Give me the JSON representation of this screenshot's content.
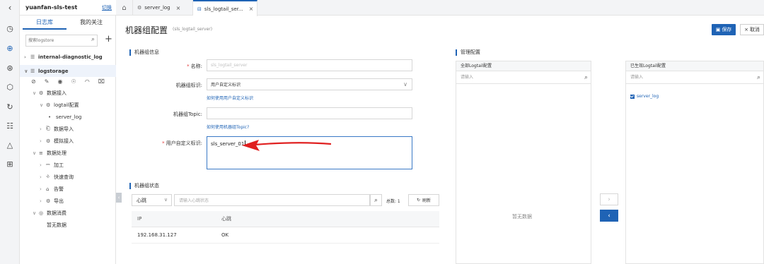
{
  "rail": {
    "back_icon": "chevron-left-icon",
    "icons": [
      "clock-icon",
      "search-icon",
      "search-plus-icon",
      "box-icon",
      "history-icon",
      "report-icon",
      "bell-icon",
      "grid-icon"
    ]
  },
  "project": {
    "name": "yuanfan-sls-test",
    "switch_label": "切换"
  },
  "tabs": [
    {
      "label": "server_log",
      "icon": "gear-icon"
    },
    {
      "label": "sls_logtail_ser...",
      "icon": "server-icon"
    }
  ],
  "sidebar": {
    "tab_logstores": "日志库",
    "tab_favorites": "我的关注",
    "search_placeholder": "搜索logstore",
    "items": [
      "internal-diagnostic_log",
      "logstorage",
      "数据接入",
      "logtail配置",
      "server_log",
      "数据导入",
      "模拟接入",
      "数据处理",
      "加工",
      "快速查询",
      "告警",
      "导出",
      "数据消费",
      "暂无数据"
    ]
  },
  "page": {
    "title": "机器组配置",
    "subtitle": "(sls_logtail_server)",
    "save_label": "保存",
    "cancel_label": "取消"
  },
  "info": {
    "section_title": "机器组信息",
    "name_label": "名称:",
    "name_value": "sls_logtail_server",
    "identity_label": "机器组标识:",
    "identity_value": "用户自定义标识",
    "identity_help": "如何使用用户自定义标识",
    "topic_label": "机器组Topic:",
    "topic_help": "如何使用机器组Topic?",
    "custom_label": "用户自定义标识:",
    "custom_value": "sls_server_01"
  },
  "status": {
    "section_title": "机器组状态",
    "heartbeat_select": "心跳",
    "heartbeat_placeholder": "请输入心跳状态",
    "total_label": "总数: 1",
    "refresh_label": "刷新",
    "columns": [
      "IP",
      "心跳"
    ],
    "rows": [
      {
        "ip": "192.168.31.127",
        "heartbeat": "OK"
      }
    ]
  },
  "manage": {
    "section_title": "管理配置",
    "all_title": "全部Logtail配置",
    "all_placeholder": "请输入",
    "empty_text": "暂无数据",
    "applied_title": "已生效Logtail配置",
    "applied_placeholder": "请输入",
    "applied_items": [
      "server_log"
    ]
  },
  "colors": {
    "accent": "#1f63b5",
    "annotation_arrow": "#e02020"
  }
}
